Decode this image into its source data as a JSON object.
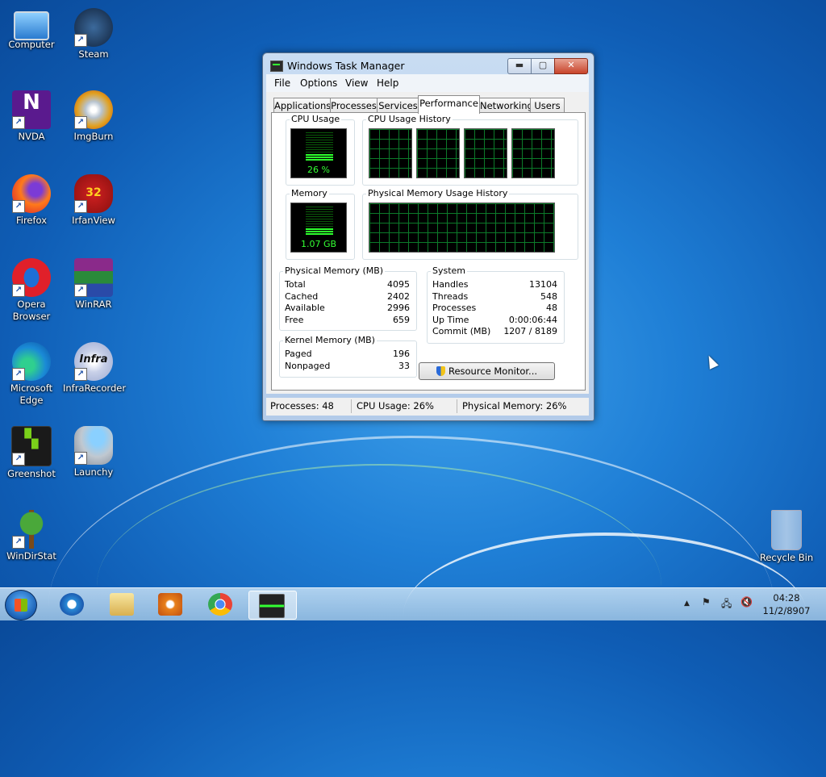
{
  "desktop": {
    "icons": [
      {
        "label": "Computer"
      },
      {
        "label": "Steam"
      },
      {
        "label": "NVDA"
      },
      {
        "label": "ImgBurn"
      },
      {
        "label": "Firefox"
      },
      {
        "label": "IrfanView"
      },
      {
        "label": "Opera Browser"
      },
      {
        "label": "WinRAR"
      },
      {
        "label": "Microsoft Edge"
      },
      {
        "label": "InfraRecorder"
      },
      {
        "label": "Greenshot"
      },
      {
        "label": "Launchy"
      },
      {
        "label": "WinDirStat"
      },
      {
        "label": "Recycle Bin"
      }
    ],
    "irfanview_badge": "32",
    "nvda_badge": "N",
    "infra_badge": "Infra"
  },
  "window": {
    "title": "Windows Task Manager",
    "buttons": {
      "min": "▬",
      "max": "▢",
      "close": "✕"
    },
    "menu": [
      "File",
      "Options",
      "View",
      "Help"
    ],
    "tabs": [
      "Applications",
      "Processes",
      "Services",
      "Performance",
      "Networking",
      "Users"
    ],
    "active_tab": "Performance",
    "cpu_usage": {
      "label": "CPU Usage",
      "value": "26 %",
      "level": 0.26
    },
    "cpu_history": {
      "label": "CPU Usage History"
    },
    "memory": {
      "label": "Memory",
      "value": "1.07 GB",
      "level": 0.26
    },
    "mem_history": {
      "label": "Physical Memory Usage History"
    },
    "physical_memory": {
      "label": "Physical Memory (MB)",
      "rows": [
        {
          "name": "Total",
          "value": "4095"
        },
        {
          "name": "Cached",
          "value": "2402"
        },
        {
          "name": "Available",
          "value": "2996"
        },
        {
          "name": "Free",
          "value": "659"
        }
      ]
    },
    "kernel_memory": {
      "label": "Kernel Memory (MB)",
      "rows": [
        {
          "name": "Paged",
          "value": "196"
        },
        {
          "name": "Nonpaged",
          "value": "33"
        }
      ]
    },
    "system": {
      "label": "System",
      "rows": [
        {
          "name": "Handles",
          "value": "13104"
        },
        {
          "name": "Threads",
          "value": "548"
        },
        {
          "name": "Processes",
          "value": "48"
        },
        {
          "name": "Up Time",
          "value": "0:00:06:44"
        },
        {
          "name": "Commit (MB)",
          "value": "1207 / 8189"
        }
      ]
    },
    "resource_monitor_button": "Resource Monitor...",
    "statusbar": {
      "processes": "Processes: 48",
      "cpu": "CPU Usage: 26%",
      "memory": "Physical Memory: 26%"
    }
  },
  "taskbar": {
    "clock_time": "04:28",
    "clock_date": "11/2/8907",
    "tray_arrow": "▲"
  }
}
